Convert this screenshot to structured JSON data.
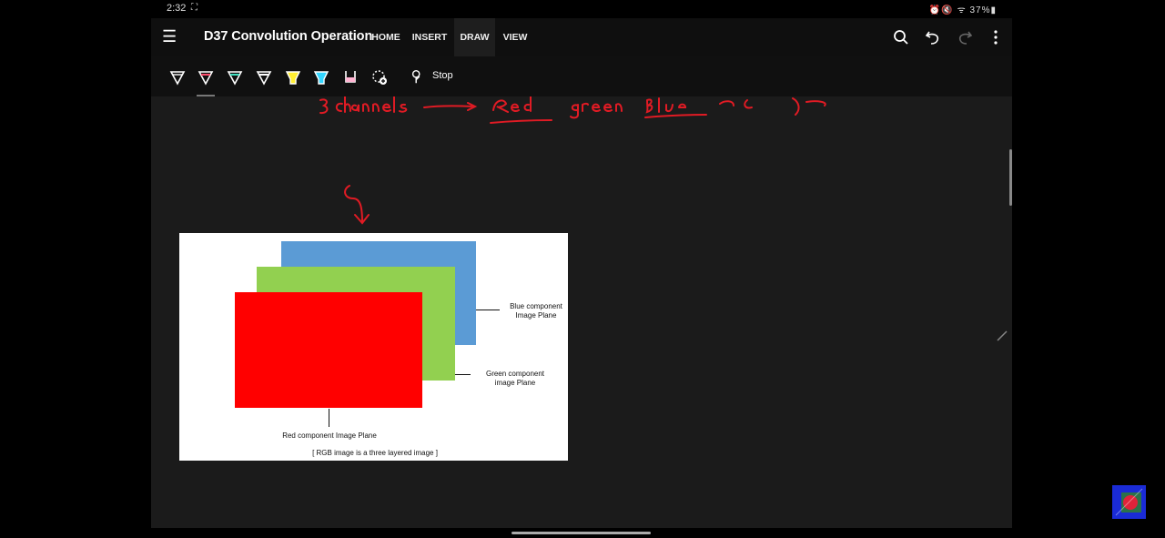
{
  "status": {
    "time": "2:32",
    "right_text": "⏰🔇 ᯤ 37%▮"
  },
  "appbar": {
    "title": "D37 Convolution Operation",
    "tabs": [
      {
        "label": "HOME",
        "active": false
      },
      {
        "label": "INSERT",
        "active": false
      },
      {
        "label": "DRAW",
        "active": true
      },
      {
        "label": "VIEW",
        "active": false
      }
    ],
    "icons": [
      "menu-icon",
      "search-icon",
      "undo-icon",
      "redo-icon",
      "more-icon"
    ]
  },
  "toolbar": {
    "pens": [
      {
        "name": "pen-white",
        "color": "#ffffff"
      },
      {
        "name": "pen-red",
        "color": "#ff4d6d"
      },
      {
        "name": "pen-teal",
        "color": "#40e0c0"
      },
      {
        "name": "pen-white-2",
        "color": "#ffffff"
      },
      {
        "name": "highlighter-yellow",
        "color": "#ffee33"
      },
      {
        "name": "highlighter-cyan",
        "color": "#33d6ff"
      },
      {
        "name": "highlighter-pink",
        "color": "#ffb3d1"
      }
    ],
    "stop_label": "Stop"
  },
  "figure": {
    "blue_label_line1": "Blue component",
    "blue_label_line2": "Image Plane",
    "green_label_line1": "Green component",
    "green_label_line2": "image Plane",
    "red_label": "Red component Image Plane",
    "caption": "[ RGB image is a three layered image ]",
    "colors": {
      "blue": "#5b9bd5",
      "green": "#92d050",
      "red": "#ff0000"
    }
  },
  "annotations": {
    "handwriting": "3 channels → Red Green Blue (...)",
    "ink_color": "#e01b24"
  }
}
